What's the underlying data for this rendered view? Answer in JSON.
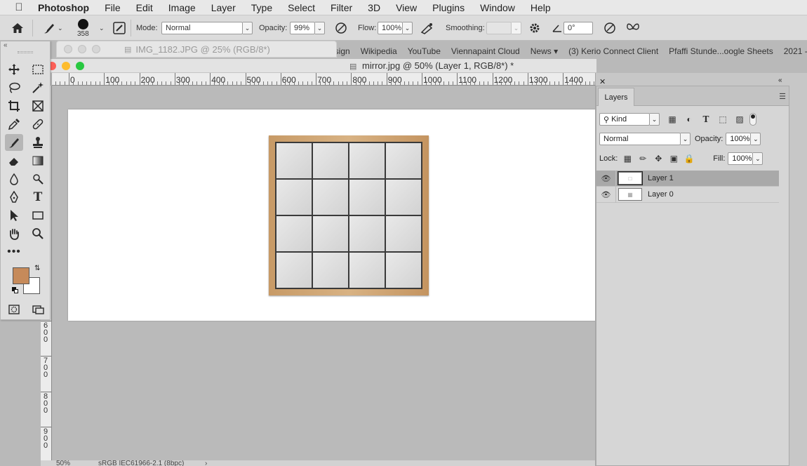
{
  "menubar": {
    "app": "Photoshop",
    "items": [
      "File",
      "Edit",
      "Image",
      "Layer",
      "Type",
      "Select",
      "Filter",
      "3D",
      "View",
      "Plugins",
      "Window",
      "Help"
    ]
  },
  "options": {
    "brush_size": "358",
    "mode_label": "Mode:",
    "mode_value": "Normal",
    "opacity_label": "Opacity:",
    "opacity_value": "99%",
    "flow_label": "Flow:",
    "flow_value": "100%",
    "smoothing_label": "Smoothing:",
    "smoothing_value": "",
    "angle_value": "0°"
  },
  "background_tab": {
    "title": "IMG_1182.JPG @ 25% (RGB/8*)"
  },
  "bookmarks": [
    "esign",
    "Wikipedia",
    "YouTube",
    "Viennapaint Cloud",
    "News ▾",
    "(3) Kerio Connect Client",
    "Pfaffi Stunde...oogle Sheets",
    "2021 -"
  ],
  "document": {
    "title": "mirror.jpg @ 50% (Layer 1, RGB/8*) *"
  },
  "ruler": {
    "h_labels": [
      "0",
      "100",
      "200",
      "300",
      "400",
      "500",
      "600",
      "700",
      "800",
      "900",
      "1000",
      "1100",
      "1200",
      "1300",
      "1400"
    ],
    "v_labels": [
      "600",
      "700",
      "800",
      "900"
    ]
  },
  "status": {
    "zoom": "50%",
    "profile": "sRGB IEC61966-2.1 (8bpc)"
  },
  "colors": {
    "foreground": "#c68a5a",
    "background": "#ffffff"
  },
  "layers_panel": {
    "tab": "Layers",
    "filter_kind": "Kind",
    "blend_mode": "Normal",
    "opacity_label": "Opacity:",
    "opacity_value": "100%",
    "lock_label": "Lock:",
    "fill_label": "Fill:",
    "fill_value": "100%",
    "layers": [
      {
        "name": "Layer 1",
        "selected": true
      },
      {
        "name": "Layer 0",
        "selected": false
      }
    ]
  }
}
